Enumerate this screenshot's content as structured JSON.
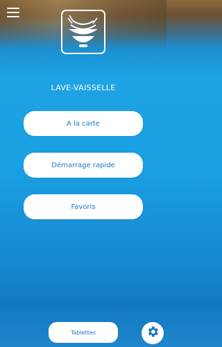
{
  "header": {
    "menu_icon": "hamburger-menu-icon",
    "logo_icon": "dishwasher-bowls-logo"
  },
  "main": {
    "title": "LAVE-VAISSELLE",
    "buttons": [
      {
        "label": "A la carte"
      },
      {
        "label": "Démarrage rapide"
      },
      {
        "label": "Favoris"
      }
    ]
  },
  "footer": {
    "tablets_label": "Tablettes",
    "settings_icon": "gear-icon"
  },
  "colors": {
    "accent": "#1876c4",
    "background": "#1a9fe2",
    "button": "#ffffff"
  }
}
